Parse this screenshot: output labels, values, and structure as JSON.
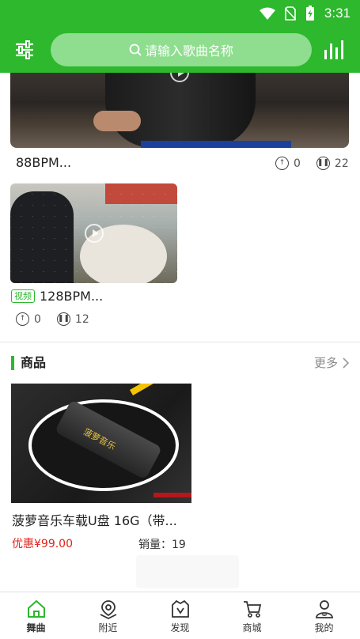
{
  "status_bar": {
    "time": "3:31"
  },
  "header": {
    "search_placeholder": "请输入歌曲名称"
  },
  "videos": [
    {
      "title": "88BPM...",
      "likes": "0",
      "plays": "22"
    },
    {
      "tag": "视频",
      "title": "128BPM...",
      "likes": "0",
      "plays": "12"
    }
  ],
  "goods_section": {
    "title": "商品",
    "more": "更多",
    "product": {
      "brand_on_image": "菠萝音乐",
      "name": "菠萝音乐车载U盘 16G（带...",
      "price": "优惠¥99.00",
      "sales": "销量：19"
    }
  },
  "tab_bar": {
    "tabs": [
      {
        "label": "舞曲",
        "icon": "home-icon",
        "active": true
      },
      {
        "label": "附近",
        "icon": "location-icon",
        "active": false
      },
      {
        "label": "发现",
        "icon": "discover-icon",
        "active": false
      },
      {
        "label": "商城",
        "icon": "cart-icon",
        "active": false
      },
      {
        "label": "我的",
        "icon": "profile-icon",
        "active": false
      }
    ]
  },
  "colors": {
    "primary": "#2db82d",
    "price": "#e2231a",
    "search_bg": "#8fdd8f"
  }
}
